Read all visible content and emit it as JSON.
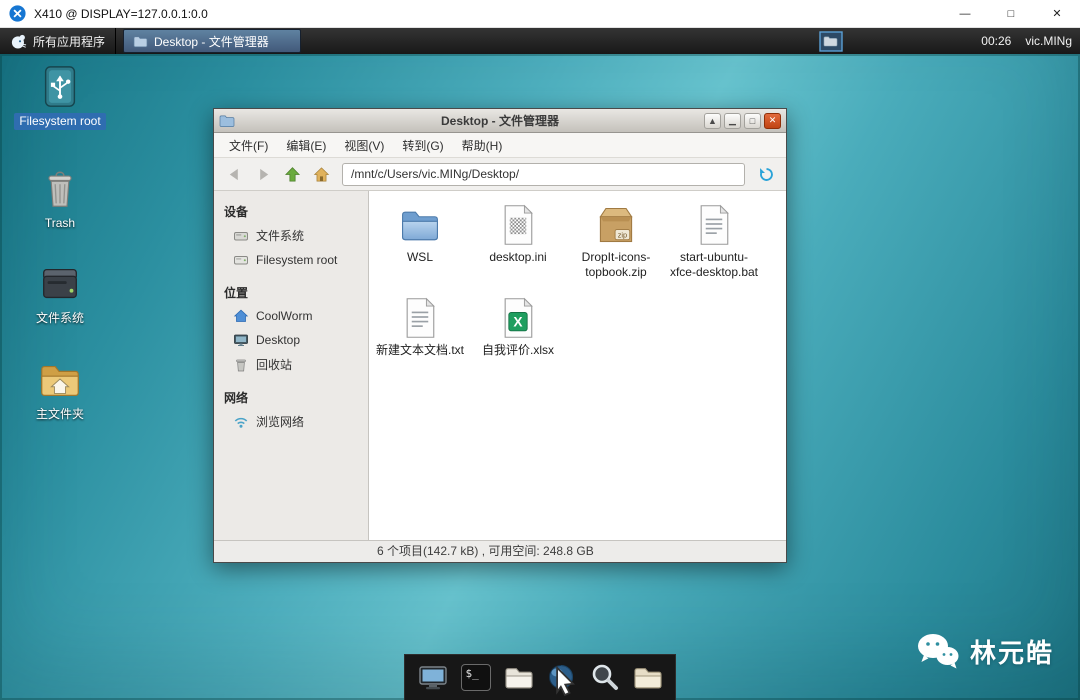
{
  "colors": {
    "desktop_teal": "#4aacbb",
    "selection_blue": "#2f6db0",
    "panel_dark": "#181818",
    "taskbutton_blue": "#42597a",
    "close_button_orange": "#c04413",
    "x410_logo_blue": "#1676d2",
    "folder_blue": "#6f9ecf",
    "xlsx_green": "#1f9e5f",
    "zip_tan": "#c8a064"
  },
  "x410": {
    "title": "X410 @ DISPLAY=127.0.0.1:0.0",
    "minimize_glyph": "—",
    "maximize_glyph": "□",
    "close_glyph": "✕"
  },
  "top_panel": {
    "apps_button_label": "所有应用程序",
    "task_button_label": "Desktop - 文件管理器",
    "clock": "00:26",
    "username": "vic.MINg"
  },
  "desktop_icons": [
    {
      "label": "Filesystem root",
      "icon": "usb-drive",
      "selected": true
    },
    {
      "label": "Trash",
      "icon": "trash-can",
      "selected": false
    },
    {
      "label": "文件系统",
      "icon": "hard-disk",
      "selected": false
    },
    {
      "label": "主文件夹",
      "icon": "home-folder",
      "selected": false
    }
  ],
  "file_manager": {
    "window_title": "Desktop - 文件管理器",
    "titlebar_buttons": {
      "rollup": "▲",
      "minimize": "▁",
      "maximize": "□",
      "close": "✕"
    },
    "menu_items": [
      "文件(F)",
      "编辑(E)",
      "视图(V)",
      "转到(G)",
      "帮助(H)"
    ],
    "toolbar": {
      "path_value": "/mnt/c/Users/vic.MINg/Desktop/"
    },
    "sidebar": {
      "sections": [
        {
          "header": "设备",
          "items": [
            {
              "label": "文件系统",
              "icon": "drive"
            },
            {
              "label": "Filesystem root",
              "icon": "drive"
            }
          ]
        },
        {
          "header": "位置",
          "items": [
            {
              "label": "CoolWorm",
              "icon": "home"
            },
            {
              "label": "Desktop",
              "icon": "desktop"
            },
            {
              "label": "回收站",
              "icon": "trash"
            }
          ]
        },
        {
          "header": "网络",
          "items": [
            {
              "label": "浏览网络",
              "icon": "network"
            }
          ]
        }
      ]
    },
    "files": [
      {
        "name": "WSL",
        "icon": "folder"
      },
      {
        "name": "desktop.ini",
        "icon": "config-file"
      },
      {
        "name": "DropIt-icons-topbook.zip",
        "icon": "zip-archive"
      },
      {
        "name": "start-ubuntu-xfce-desktop.bat",
        "icon": "script-file"
      },
      {
        "name": "新建文本文档.txt",
        "icon": "text-file"
      },
      {
        "name": "自我评价.xlsx",
        "icon": "spreadsheet"
      }
    ],
    "status_text": "6 个项目(142.7 kB) , 可用空间: 248.8 GB"
  },
  "icon_glyphs": {
    "zip_badge": "zip",
    "xlsx_letter": "X",
    "terminal_prompt": "$_"
  },
  "dock_items": [
    {
      "icon": "show-desktop"
    },
    {
      "icon": "terminal"
    },
    {
      "icon": "file-manager"
    },
    {
      "icon": "web-browser"
    },
    {
      "icon": "search"
    },
    {
      "icon": "files"
    }
  ],
  "watermark": {
    "name": "林元皓"
  }
}
